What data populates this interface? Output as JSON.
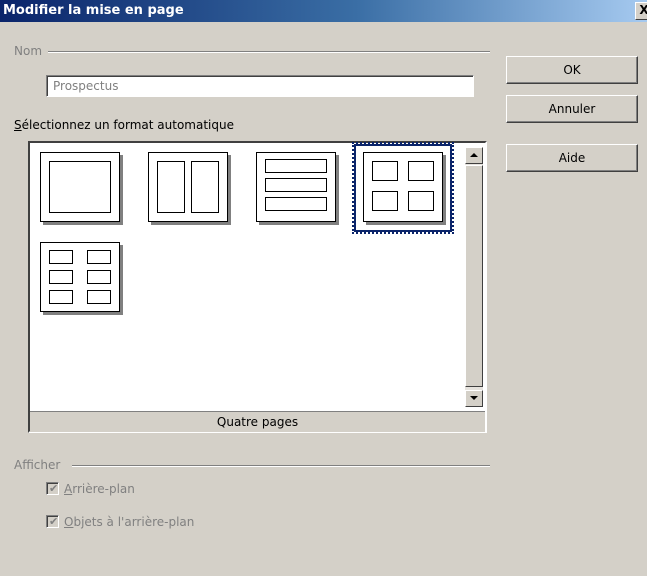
{
  "window": {
    "title": "Modifier la mise en page",
    "close_glyph": "X"
  },
  "name_group": {
    "label": "Nom",
    "value": "Prospectus"
  },
  "format_section": {
    "label_mnemonic": "S",
    "label_rest": "électionnez un format automatique",
    "layouts": [
      {
        "id": "one-page"
      },
      {
        "id": "two-pages"
      },
      {
        "id": "three-pages"
      },
      {
        "id": "four-pages",
        "selected": true
      },
      {
        "id": "six-pages"
      }
    ],
    "status": "Quatre pages"
  },
  "buttons": {
    "ok": "OK",
    "cancel": "Annuler",
    "help": "Aide"
  },
  "display_group": {
    "label": "Afficher",
    "background": {
      "mnemonic": "A",
      "rest": "rrière-plan",
      "checked": true
    },
    "background_objects": {
      "mnemonic": "O",
      "rest": "bjets à l'arrière-plan",
      "checked": true
    }
  },
  "colors": {
    "title_start": "#0a246a",
    "title_end": "#a6caf0",
    "selection": "#0a246a",
    "face": "#d4d0c8"
  }
}
